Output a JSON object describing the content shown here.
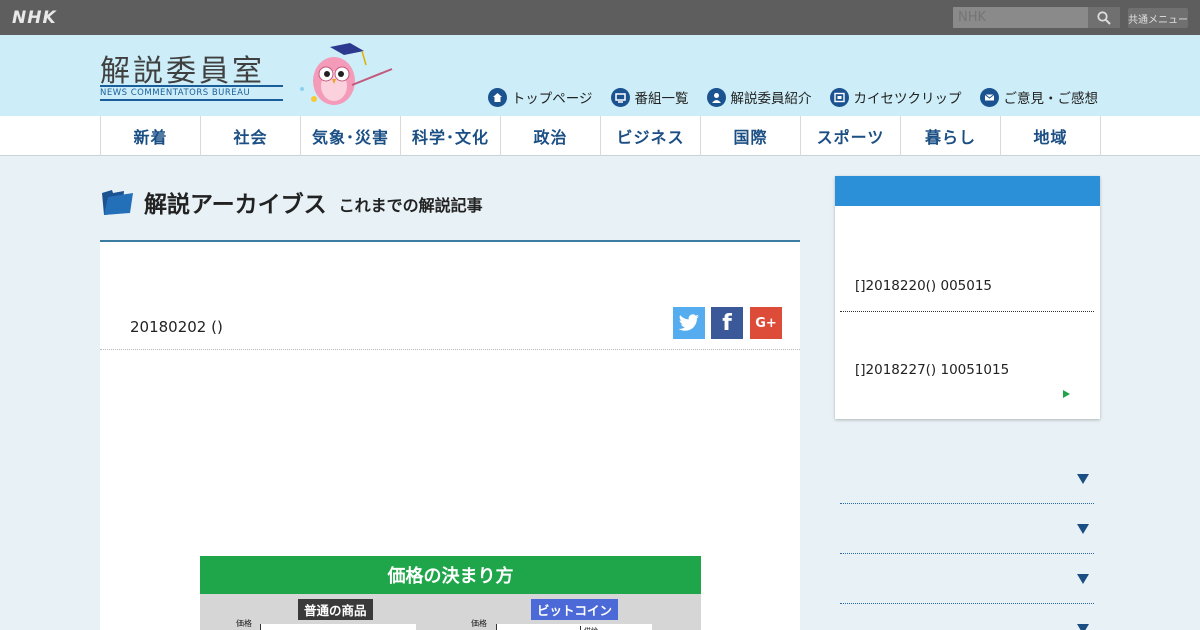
{
  "topbar": {
    "logo": "NHK",
    "search_placeholder": "NHK",
    "common_menu": "共通メニュー"
  },
  "header": {
    "site_title": "解説委員室",
    "site_subtitle": "NEWS COMMENTATORS BUREAU",
    "nav": [
      {
        "label": "トップページ",
        "icon": "home-icon"
      },
      {
        "label": "番組一覧",
        "icon": "tv-icon"
      },
      {
        "label": "解説委員紹介",
        "icon": "person-icon"
      },
      {
        "label": "カイセツクリップ",
        "icon": "film-icon"
      },
      {
        "label": "ご意見・ご感想",
        "icon": "mail-icon"
      }
    ]
  },
  "categories": [
    "新着",
    "社会",
    "気象･災害",
    "科学･文化",
    "政治",
    "ビジネス",
    "国際",
    "スポーツ",
    "暮らし",
    "地域"
  ],
  "archive": {
    "title": "解説アーカイブス",
    "subtitle": "これまでの解説記事"
  },
  "article": {
    "date": "20180202 ()",
    "share": {
      "twitter": "twitter-icon",
      "facebook": "f",
      "google": "G+"
    },
    "figure": {
      "title": "価格の決まり方",
      "label_left": "普通の商品",
      "label_right": "ビットコイン",
      "axis_left": "価格",
      "axis_right": "価格",
      "right_inner": "供給"
    }
  },
  "sidebar": {
    "items": [
      "[]2018220() 005015",
      "[]2018227() 10051015"
    ]
  },
  "colors": {
    "topbar": "#5e5e5e",
    "header_bg": "#cdeef8",
    "nav_text": "#1b4f84",
    "sidebar_head": "#2c90d8",
    "figure_green": "#1fa64a"
  }
}
